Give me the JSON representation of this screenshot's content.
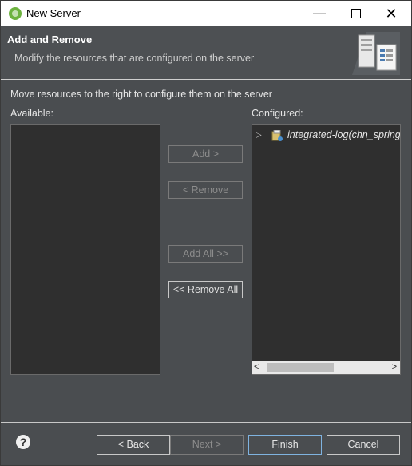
{
  "window": {
    "title": "New Server"
  },
  "header": {
    "title": "Add and Remove",
    "description": "Modify the resources that are configured on the server"
  },
  "instructions": "Move resources to the right to configure them on the server",
  "available": {
    "label": "Available:",
    "items": []
  },
  "configured": {
    "label": "Configured:",
    "items": [
      {
        "label": "integrated-log(chn_spring_"
      }
    ]
  },
  "buttons": {
    "add": "Add >",
    "remove": "< Remove",
    "add_all": "Add All >>",
    "remove_all": "<< Remove All"
  },
  "footer": {
    "back": "< Back",
    "next": "Next >",
    "finish": "Finish",
    "cancel": "Cancel"
  },
  "icons": {
    "app": "spring-icon",
    "help": "help-icon",
    "header": "server-wizard-icon",
    "project": "project-icon"
  }
}
